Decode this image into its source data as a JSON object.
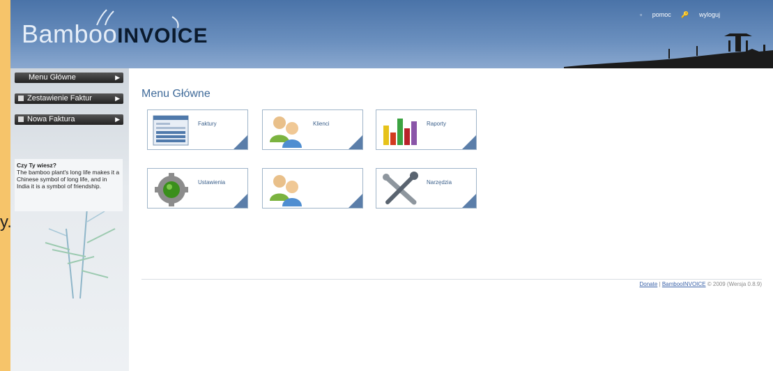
{
  "header": {
    "logo_light": "Bamboo",
    "logo_bold": "INVOICE",
    "links": [
      "pomoc",
      "wyloguj"
    ]
  },
  "sidebar": {
    "items": [
      {
        "label": "Menu Główne"
      },
      {
        "label": "Zestawienie Faktur"
      },
      {
        "label": "Nowa Faktura"
      }
    ],
    "tip": {
      "title": "Czy Ty wiesz?",
      "text": "The bamboo plant's long life makes it a Chinese symbol of long life, and in India it is a symbol of friendship."
    },
    "stray_text": "y."
  },
  "main": {
    "title": "Menu Główne",
    "tiles": [
      {
        "label": "Faktury",
        "icon": "invoice-icon"
      },
      {
        "label": "Klienci",
        "icon": "clients-icon"
      },
      {
        "label": "Raporty",
        "icon": "reports-icon"
      },
      {
        "label": "Ustawienia",
        "icon": "settings-gear-icon"
      },
      {
        "label": "",
        "icon": "users-icon"
      },
      {
        "label": "Narzędzia",
        "icon": "tools-icon"
      }
    ]
  },
  "footer": {
    "donate": "Donate",
    "separator": "|",
    "brand": "BambooINVOICE",
    "copyright": "© 2009 (Wersja 0.8.9)"
  },
  "colors": {
    "outer_background": "#f6c46a",
    "header_blue": "#4a73a8",
    "title_blue": "#3f6a99",
    "tile_corner": "#5b7ea9"
  }
}
